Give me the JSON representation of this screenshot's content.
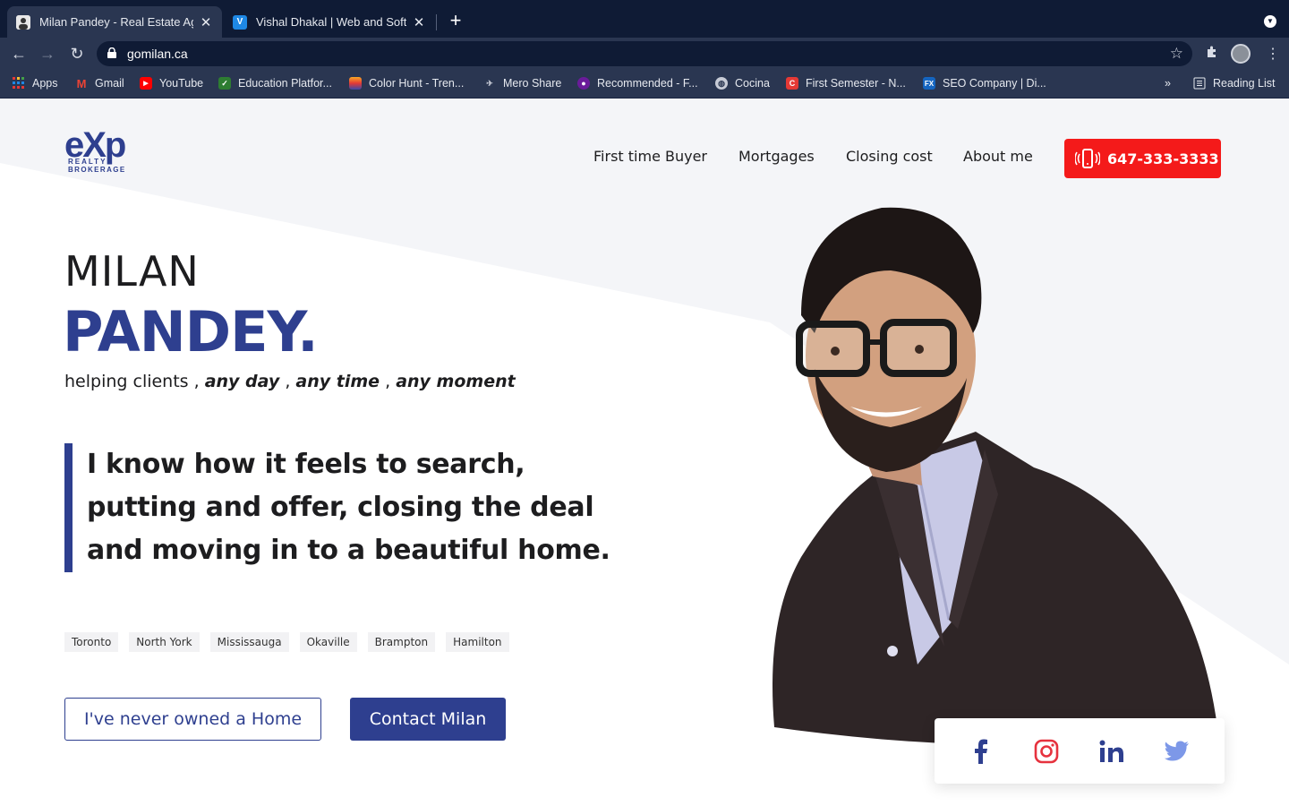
{
  "browser": {
    "tabs": [
      {
        "title": "Milan Pandey - Real Estate Age",
        "active": true
      },
      {
        "title": "Vishal Dhakal | Web and Softw",
        "active": false
      }
    ],
    "new_tab_label": "+",
    "url": "gomilan.ca",
    "bookmarks": [
      {
        "label": "Apps",
        "icon": "apps-grid-icon"
      },
      {
        "label": "Gmail",
        "icon": "gmail-icon"
      },
      {
        "label": "YouTube",
        "icon": "youtube-icon"
      },
      {
        "label": "Education Platfor...",
        "icon": "education-icon"
      },
      {
        "label": "Color Hunt - Tren...",
        "icon": "colorhunt-icon"
      },
      {
        "label": "Mero Share",
        "icon": "meroshare-icon"
      },
      {
        "label": "Recommended - F...",
        "icon": "recommended-icon"
      },
      {
        "label": "Cocina",
        "icon": "globe-icon"
      },
      {
        "label": "First Semester - N...",
        "icon": "c-icon"
      },
      {
        "label": "SEO Company | Di...",
        "icon": "fx-icon"
      }
    ],
    "overflow_label": "»",
    "reading_list_label": "Reading List"
  },
  "header": {
    "logo": {
      "main": "eXp",
      "line1": "REALTY",
      "line2": "BROKERAGE"
    },
    "nav": [
      "First time Buyer",
      "Mortgages",
      "Closing cost",
      "About me"
    ],
    "phone": "647-333-3333"
  },
  "hero": {
    "first_name": "MILAN",
    "last_name": "PANDEY.",
    "tagline": {
      "prefix": "helping clients ,",
      "item1": "any day",
      "sep1": ",",
      "item2": "any time",
      "sep2": ",",
      "item3": "any moment"
    },
    "quote": "I know how it feels to search, putting and offer, closing the deal and moving in to a beautiful home.",
    "cities": [
      "Toronto",
      "North York",
      "Mississauga",
      "Okaville",
      "Brampton",
      "Hamilton"
    ],
    "cta_secondary": "I've never owned a Home",
    "cta_primary": "Contact Milan"
  },
  "social": [
    "facebook-icon",
    "instagram-icon",
    "linkedin-icon",
    "twitter-icon"
  ],
  "colors": {
    "brand": "#2e3f8f",
    "phone_button": "#f41a1a",
    "chrome_dark": "#0f1b35",
    "chrome_mid": "#2a3651"
  }
}
